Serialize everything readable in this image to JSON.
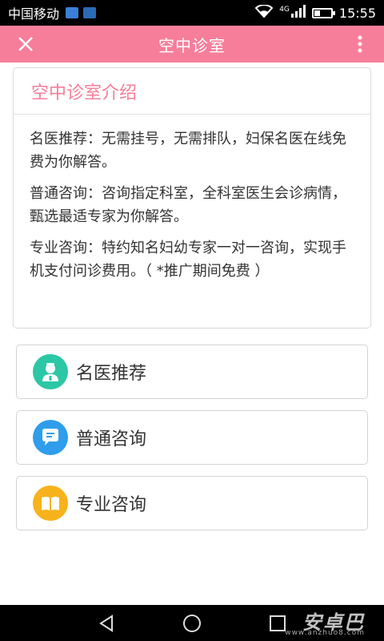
{
  "status_bar": {
    "carrier": "中国移动",
    "network": "4G",
    "time": "15:55",
    "battery_level": 0.35,
    "icons": [
      "notification-icon",
      "app-badge-icon",
      "wifi-icon",
      "signal-icon",
      "battery-icon"
    ]
  },
  "app_bar": {
    "title": "空中诊室",
    "close_icon": "close-icon",
    "more_icon": "more-vertical-icon",
    "color": "#F67E9A"
  },
  "intro": {
    "title": "空中诊室介绍",
    "paragraphs": [
      "名医推荐：无需挂号，无需排队，妇保名医在线免费为你解答。",
      "普通咨询：咨询指定科室，全科室医生会诊病情，甄选最适专家为你解答。",
      "专业咨询：特约知名妇幼专家一对一咨询，实现手机支付问诊费用。（ *推广期间免费 ）"
    ]
  },
  "menu": [
    {
      "label": "名医推荐",
      "icon": "doctor-icon",
      "color": "#2CC7A5"
    },
    {
      "label": "普通咨询",
      "icon": "chat-bubble-icon",
      "color": "#2F9DEB"
    },
    {
      "label": "专业咨询",
      "icon": "book-icon",
      "color": "#F7B21C"
    }
  ],
  "nav_bar": {
    "icons": [
      "back-icon",
      "home-icon",
      "recents-icon"
    ],
    "watermark": "安卓巴",
    "watermark_sub": "www.anzhuo8.com"
  }
}
